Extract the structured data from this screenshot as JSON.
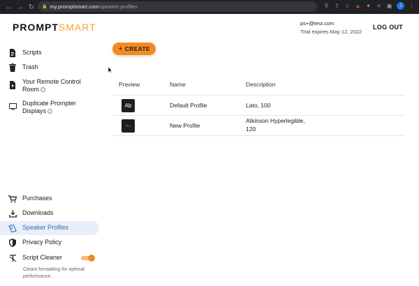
{
  "browser": {
    "url_domain": "my.promptsmart.com",
    "url_path": "/speaker-profiles",
    "profile_initial": "J"
  },
  "header": {
    "logo_part1": "PROMPT",
    "logo_part2": "SMART",
    "email": "ps+@test.com",
    "trial": "Trial expires May 12, 2022",
    "logout": "LOG OUT"
  },
  "sidebar": {
    "scripts": "Scripts",
    "trash": "Trash",
    "remote_line1": "Your Remote Control",
    "remote_line2": "Room",
    "duplicate_line1": "Duplicate Prompter",
    "duplicate_line2": "Displays",
    "purchases": "Purchases",
    "downloads": "Downloads",
    "speaker_profiles": "Speaker Profiles",
    "privacy": "Privacy Policy",
    "cleaner": "Script Cleaner",
    "cleaner_note": "Clears formatting for optimal performance.",
    "cleaner_enabled": true
  },
  "main": {
    "create_label": "CREATE",
    "columns": [
      "Preview",
      "Name",
      "Description"
    ],
    "rows": [
      {
        "preview": "Ab",
        "name": "Default Profile",
        "desc1": "Lato, 100",
        "desc2": ""
      },
      {
        "preview": "abc",
        "name": "New Profile",
        "desc1": "Atkinson Hyperlegible,",
        "desc2": "120"
      }
    ]
  },
  "colors": {
    "accent": "#f58a1f",
    "active_bg": "#e8eff8",
    "active_text": "#2f6fb0"
  }
}
